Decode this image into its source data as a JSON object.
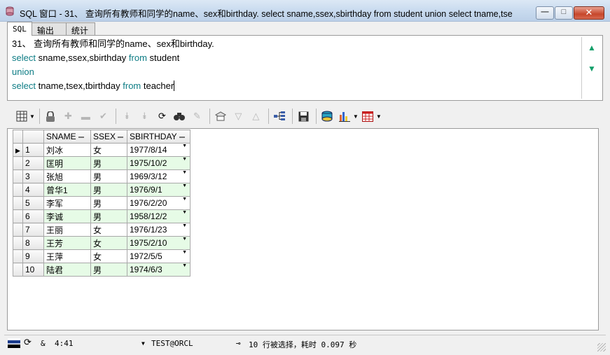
{
  "window": {
    "title": "SQL 窗口 - 31、 查询所有教师和同学的name、sex和birthday. select sname,ssex,sbirthday from student union select tname,tse",
    "buttons": {
      "minimize": "—",
      "maximize": "□",
      "close": "✕"
    }
  },
  "tabs": [
    "SQL",
    "输出",
    "统计"
  ],
  "editor": {
    "lines": [
      {
        "parts": [
          {
            "text": "31、 查询所有教师和同学的name、sex和birthday.",
            "kw": false
          }
        ]
      },
      {
        "parts": [
          {
            "text": "select",
            "kw": true
          },
          {
            "text": " sname,ssex,sbirthday ",
            "kw": false
          },
          {
            "text": "from",
            "kw": true
          },
          {
            "text": " student",
            "kw": false
          }
        ]
      },
      {
        "parts": [
          {
            "text": "union",
            "kw": true
          }
        ]
      },
      {
        "parts": [
          {
            "text": "select",
            "kw": true
          },
          {
            "text": " tname,tsex,tbirthday ",
            "kw": false
          },
          {
            "text": "from",
            "kw": true
          },
          {
            "text": " teacher",
            "kw": false
          }
        ]
      }
    ],
    "scroll_up": "▲",
    "scroll_down": "▼"
  },
  "toolbar": {
    "icons": [
      "grid-view-icon",
      "lock-icon",
      "add-record-icon",
      "delete-record-icon",
      "post-record-icon",
      "fetch-next-icon",
      "fetch-last-icon",
      "refresh-icon",
      "find-icon",
      "clear-icon",
      "query-by-example-icon",
      "previous-icon",
      "next-icon",
      "record-tree-icon",
      "save-icon",
      "export-icon",
      "chart-icon",
      "table-icon"
    ]
  },
  "grid": {
    "columns": [
      "SNAME",
      "SSEX",
      "SBIRTHDAY"
    ],
    "rows": [
      [
        "1",
        "刘冰",
        "女",
        "1977/8/14"
      ],
      [
        "2",
        "匡明",
        "男",
        "1975/10/2"
      ],
      [
        "3",
        "张旭",
        "男",
        "1969/3/12"
      ],
      [
        "4",
        "曾华1",
        "男",
        "1976/9/1"
      ],
      [
        "5",
        "李军",
        "男",
        "1976/2/20"
      ],
      [
        "6",
        "李诚",
        "男",
        "1958/12/2"
      ],
      [
        "7",
        "王丽",
        "女",
        "1976/1/23"
      ],
      [
        "8",
        "王芳",
        "女",
        "1975/2/10"
      ],
      [
        "9",
        "王萍",
        "女",
        "1972/5/5"
      ],
      [
        "10",
        "陆君",
        "男",
        "1974/6/3"
      ]
    ],
    "current_row_marker": "▶"
  },
  "status": {
    "amp": "&",
    "cursor_pos": "4:41",
    "connection": "TEST@ORCL",
    "message": "10 行被选择，耗时 0.097 秒"
  },
  "colors": {
    "keyword": "#0e7d85",
    "alt_row": "#e6fbe6"
  }
}
